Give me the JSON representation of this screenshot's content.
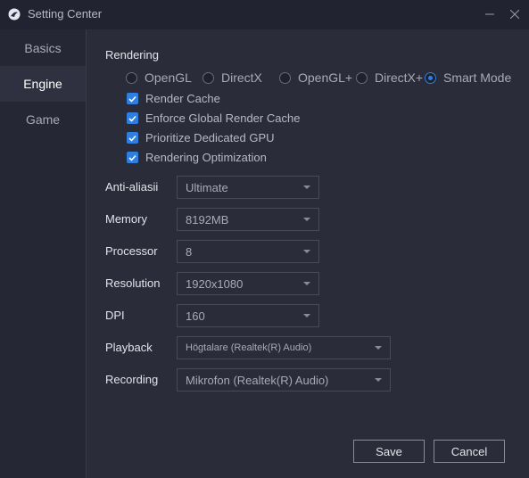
{
  "window": {
    "title": "Setting Center"
  },
  "sidebar": {
    "items": [
      {
        "label": "Basics"
      },
      {
        "label": "Engine"
      },
      {
        "label": "Game"
      }
    ]
  },
  "rendering": {
    "title": "Rendering",
    "modes": [
      "OpenGL",
      "DirectX",
      "OpenGL+",
      "DirectX+",
      "Smart Mode"
    ],
    "selected_mode": "Smart Mode",
    "options": [
      {
        "label": "Render Cache",
        "checked": true
      },
      {
        "label": "Enforce Global Render Cache",
        "checked": true
      },
      {
        "label": "Prioritize Dedicated GPU",
        "checked": true
      },
      {
        "label": "Rendering Optimization",
        "checked": true
      }
    ]
  },
  "fields": {
    "anti_aliasing": {
      "label": "Anti-aliasii",
      "value": "Ultimate"
    },
    "memory": {
      "label": "Memory",
      "value": "8192MB"
    },
    "processor": {
      "label": "Processor",
      "value": "8"
    },
    "resolution": {
      "label": "Resolution",
      "value": "1920x1080"
    },
    "dpi": {
      "label": "DPI",
      "value": "160"
    },
    "playback": {
      "label": "Playback",
      "value": "Högtalare (Realtek(R) Audio)"
    },
    "recording": {
      "label": "Recording",
      "value": "Mikrofon (Realtek(R) Audio)"
    }
  },
  "buttons": {
    "save": "Save",
    "cancel": "Cancel"
  },
  "colors": {
    "accent": "#2f7fe0",
    "background": "#2b2c3a",
    "sidebar": "#262735"
  }
}
